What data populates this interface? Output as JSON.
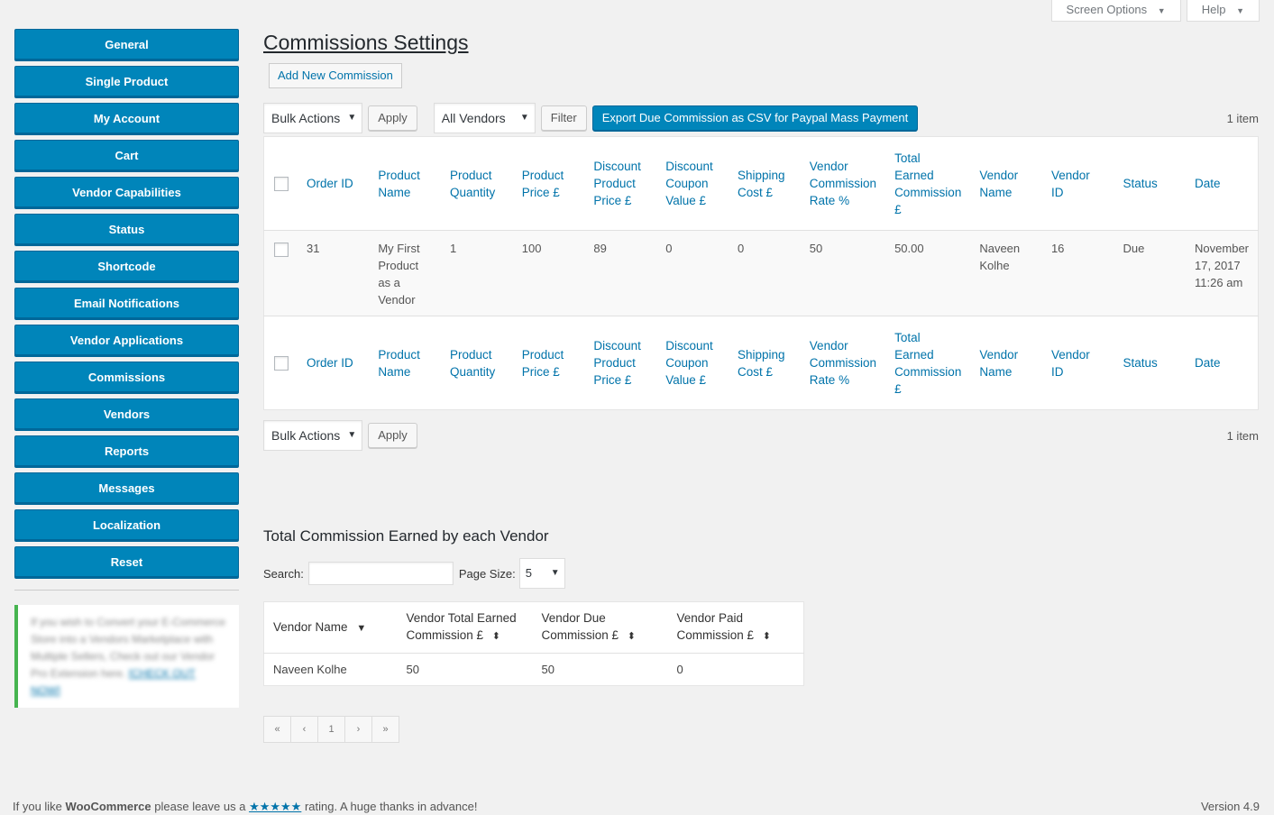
{
  "screen_meta": {
    "screen_options": "Screen Options",
    "help": "Help"
  },
  "sidebar": {
    "items": [
      {
        "label": "General"
      },
      {
        "label": "Single Product"
      },
      {
        "label": "My Account"
      },
      {
        "label": "Cart"
      },
      {
        "label": "Vendor Capabilities"
      },
      {
        "label": "Status"
      },
      {
        "label": "Shortcode"
      },
      {
        "label": "Email Notifications"
      },
      {
        "label": "Vendor Applications"
      },
      {
        "label": "Commissions"
      },
      {
        "label": "Vendors"
      },
      {
        "label": "Reports"
      },
      {
        "label": "Messages"
      },
      {
        "label": "Localization"
      },
      {
        "label": "Reset"
      }
    ],
    "promo_text": "If you wish to Convert your E-Commerce Store into a Vendors Marketplace with Multiple Sellers, Check out our Vendor Pro Extension here.",
    "promo_link": "[CHECK OUT NOW]"
  },
  "page": {
    "title": "Commissions Settings",
    "add_new": "Add New Commission"
  },
  "tablenav": {
    "bulk_actions": "Bulk Actions",
    "apply": "Apply",
    "vendor_filter": "All Vendors",
    "filter": "Filter",
    "export": "Export Due Commission as CSV for Paypal Mass Payment",
    "items_count": "1 item"
  },
  "commissions_table": {
    "columns": [
      "Order ID",
      "Product Name",
      "Product Quantity",
      "Product Price £",
      "Discount Product Price £",
      "Discount Coupon Value £",
      "Shipping Cost £",
      "Vendor Commission Rate %",
      "Total Earned Commission £",
      "Vendor Name",
      "Vendor ID",
      "Status",
      "Date"
    ],
    "rows": [
      {
        "order_id": "31",
        "product_name": "My First Product as a Vendor",
        "product_quantity": "1",
        "product_price": "100",
        "discount_product_price": "89",
        "discount_coupon_value": "0",
        "shipping_cost": "0",
        "commission_rate": "50",
        "total_earned": "50.00",
        "vendor_name": "Naveen Kolhe",
        "vendor_id": "16",
        "status": "Due",
        "date": "November 17, 2017 11:26 am"
      }
    ]
  },
  "vendor_totals": {
    "title": "Total Commission Earned by each Vendor",
    "search_label": "Search:",
    "search_value": "",
    "page_size_label": "Page Size:",
    "page_size": "5",
    "columns": [
      "Vendor Name",
      "Vendor Total Earned Commission £",
      "Vendor Due Commission £",
      "Vendor Paid Commission £"
    ],
    "rows": [
      {
        "vendor_name": "Naveen Kolhe",
        "total": "50",
        "due": "50",
        "paid": "0"
      }
    ],
    "pager": {
      "first": "«",
      "prev": "‹",
      "current": "1",
      "next": "›",
      "last": "»"
    }
  },
  "footer": {
    "text_before": "If you like ",
    "brand": "WooCommerce",
    "text_middle": " please leave us a ",
    "stars": "★★★★★",
    "text_after": " rating. A huge thanks in advance!",
    "version": "Version 4.9"
  }
}
